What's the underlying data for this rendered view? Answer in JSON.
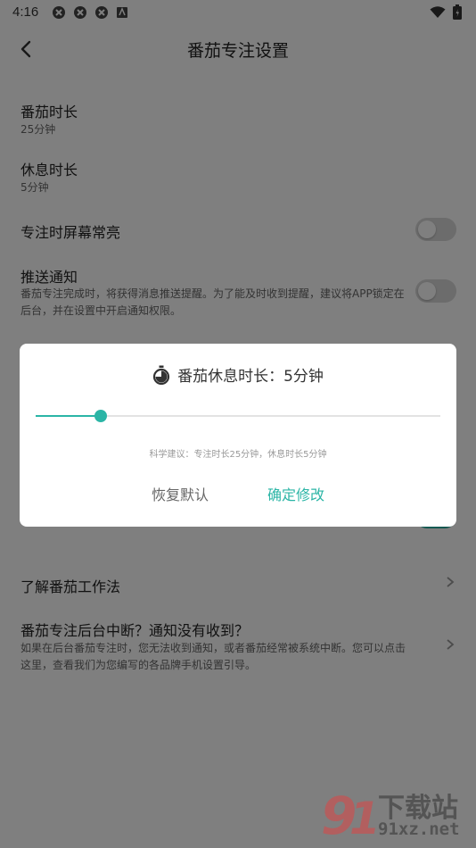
{
  "status_bar": {
    "time": "4:16",
    "icons": [
      "notification-icon",
      "notification-icon",
      "notification-icon",
      "keyboard-icon"
    ],
    "right_icons": [
      "wifi-icon",
      "battery-icon"
    ]
  },
  "app_bar": {
    "title": "番茄专注设置",
    "back_icon": "back-arrow-icon"
  },
  "settings": {
    "focus_duration": {
      "title": "番茄时长",
      "value": "25分钟"
    },
    "break_duration": {
      "title": "休息时长",
      "value": "5分钟"
    },
    "screen_on": {
      "title": "专注时屏幕常亮",
      "enabled": false
    },
    "push": {
      "title": "推送通知",
      "description": "番茄专注完成时，将获得消息推送提醒。为了能及时收到提醒，建议将APP锁定在后台，并在设置中开启通知权限。",
      "enabled": false
    },
    "hidden_row_enabled": true,
    "learn": {
      "title": "了解番茄工作法"
    },
    "background": {
      "title": "番茄专注后台中断？通知没有收到？",
      "description": "如果在后台番茄专注时，您无法收到通知，或者番茄经常被系统中断。您可以点击这里，查看我们为您编写的各品牌手机设置引导。"
    }
  },
  "dialog": {
    "title": "番茄休息时长：5分钟",
    "icon": "stopwatch-icon",
    "slider_fraction": 0.16,
    "hint": "科学建议：专注时长25分钟，休息时长5分钟",
    "reset_label": "恢复默认",
    "confirm_label": "确定修改"
  },
  "colors": {
    "accent": "#2bb5a6",
    "scrim": "rgba(0,0,0,0.5)",
    "toggle_off": "#d8d8d8"
  },
  "watermark": {
    "text_main": "下载站",
    "text_site": "91xz.net"
  }
}
